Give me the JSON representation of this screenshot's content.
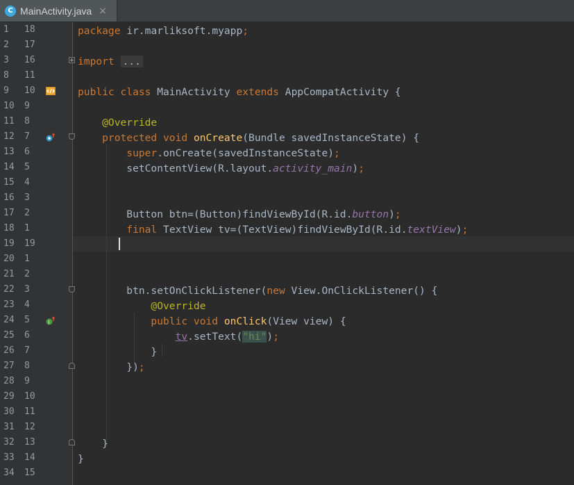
{
  "tab": {
    "icon_letter": "C",
    "filename": "MainActivity.java",
    "close": "×"
  },
  "colors": {
    "background": "#2b2b2b",
    "gutter": "#313335",
    "keyword": "#cc7832",
    "annotation": "#bbb529",
    "method": "#ffc66d",
    "string": "#6a8759",
    "field": "#9876aa"
  },
  "gutter_rows": [
    {
      "n1": "1",
      "n2": "18"
    },
    {
      "n1": "2",
      "n2": "17"
    },
    {
      "n1": "3",
      "n2": "16"
    },
    {
      "n1": "8",
      "n2": "11"
    },
    {
      "n1": "9",
      "n2": "10"
    },
    {
      "n1": "10",
      "n2": "9"
    },
    {
      "n1": "11",
      "n2": "8"
    },
    {
      "n1": "12",
      "n2": "7"
    },
    {
      "n1": "13",
      "n2": "6"
    },
    {
      "n1": "14",
      "n2": "5"
    },
    {
      "n1": "15",
      "n2": "4"
    },
    {
      "n1": "16",
      "n2": "3"
    },
    {
      "n1": "17",
      "n2": "2"
    },
    {
      "n1": "18",
      "n2": "1"
    },
    {
      "n1": "19",
      "n2": "19"
    },
    {
      "n1": "20",
      "n2": "1"
    },
    {
      "n1": "21",
      "n2": "2"
    },
    {
      "n1": "22",
      "n2": "3"
    },
    {
      "n1": "23",
      "n2": "4"
    },
    {
      "n1": "24",
      "n2": "5"
    },
    {
      "n1": "25",
      "n2": "6"
    },
    {
      "n1": "26",
      "n2": "7"
    },
    {
      "n1": "27",
      "n2": "8"
    },
    {
      "n1": "28",
      "n2": "9"
    },
    {
      "n1": "29",
      "n2": "10"
    },
    {
      "n1": "30",
      "n2": "11"
    },
    {
      "n1": "31",
      "n2": "12"
    },
    {
      "n1": "32",
      "n2": "13"
    },
    {
      "n1": "33",
      "n2": "14"
    },
    {
      "n1": "34",
      "n2": "15"
    }
  ],
  "code": [
    [
      [
        "kw",
        "package"
      ],
      [
        "",
        "ir.marliksoft.myapp"
      ],
      [
        "kw",
        ";"
      ]
    ],
    [],
    [
      [
        "kw",
        "import"
      ],
      [
        "",
        ""
      ],
      [
        "fold-text",
        "..."
      ]
    ],
    [],
    [
      [
        "kw",
        "public class"
      ],
      [
        "",
        "MainActivity"
      ],
      [
        "kw",
        "extends"
      ],
      [
        "",
        "AppCompatActivity {"
      ]
    ],
    [],
    [
      [
        "ann",
        "    @Override"
      ]
    ],
    [
      [
        "kw",
        "    protected void"
      ],
      [
        "fn",
        "onCreate"
      ],
      [
        "",
        "(Bundle savedInstanceState) {"
      ]
    ],
    [
      [
        "kw",
        "        super"
      ],
      [
        "",
        ".onCreate(savedInstanceState)"
      ],
      [
        "kw",
        ";"
      ]
    ],
    [
      [
        "",
        "        setContentView(R.layout."
      ],
      [
        "ital",
        "activity_main"
      ],
      [
        "",
        ")"
      ],
      [
        "kw",
        ";"
      ]
    ],
    [],
    [],
    [
      [
        "",
        "        Button btn=(Button)findViewById(R.id."
      ],
      [
        "ital",
        "button"
      ],
      [
        "",
        ")"
      ],
      [
        "kw",
        ";"
      ]
    ],
    [
      [
        "kw",
        "        final"
      ],
      [
        "",
        "TextView tv=(TextView)findViewById(R.id."
      ],
      [
        "ital",
        "textView"
      ],
      [
        "",
        ")"
      ],
      [
        "kw",
        ";"
      ]
    ],
    [],
    [],
    [],
    [
      [
        "",
        "        btn.setOnClickListener("
      ],
      [
        "kw",
        "new"
      ],
      [
        "",
        "View.OnClickListener() {"
      ]
    ],
    [
      [
        "ann",
        "            @Override"
      ]
    ],
    [
      [
        "kw",
        "            public void"
      ],
      [
        "fn",
        "onClick"
      ],
      [
        "",
        "(View view) {"
      ]
    ],
    [
      [
        "",
        "                "
      ],
      [
        "fld",
        "tv"
      ],
      [
        "",
        ".setText("
      ],
      [
        "str",
        "\"hi\""
      ],
      [
        "",
        ")"
      ],
      [
        "kw",
        ";"
      ]
    ],
    [
      [
        "",
        "            }"
      ]
    ],
    [
      [
        "",
        "        })"
      ],
      [
        "kw",
        ";"
      ]
    ],
    [],
    [],
    [],
    [],
    [
      [
        "",
        "    }"
      ]
    ],
    [
      [
        "",
        "}"
      ]
    ],
    []
  ]
}
